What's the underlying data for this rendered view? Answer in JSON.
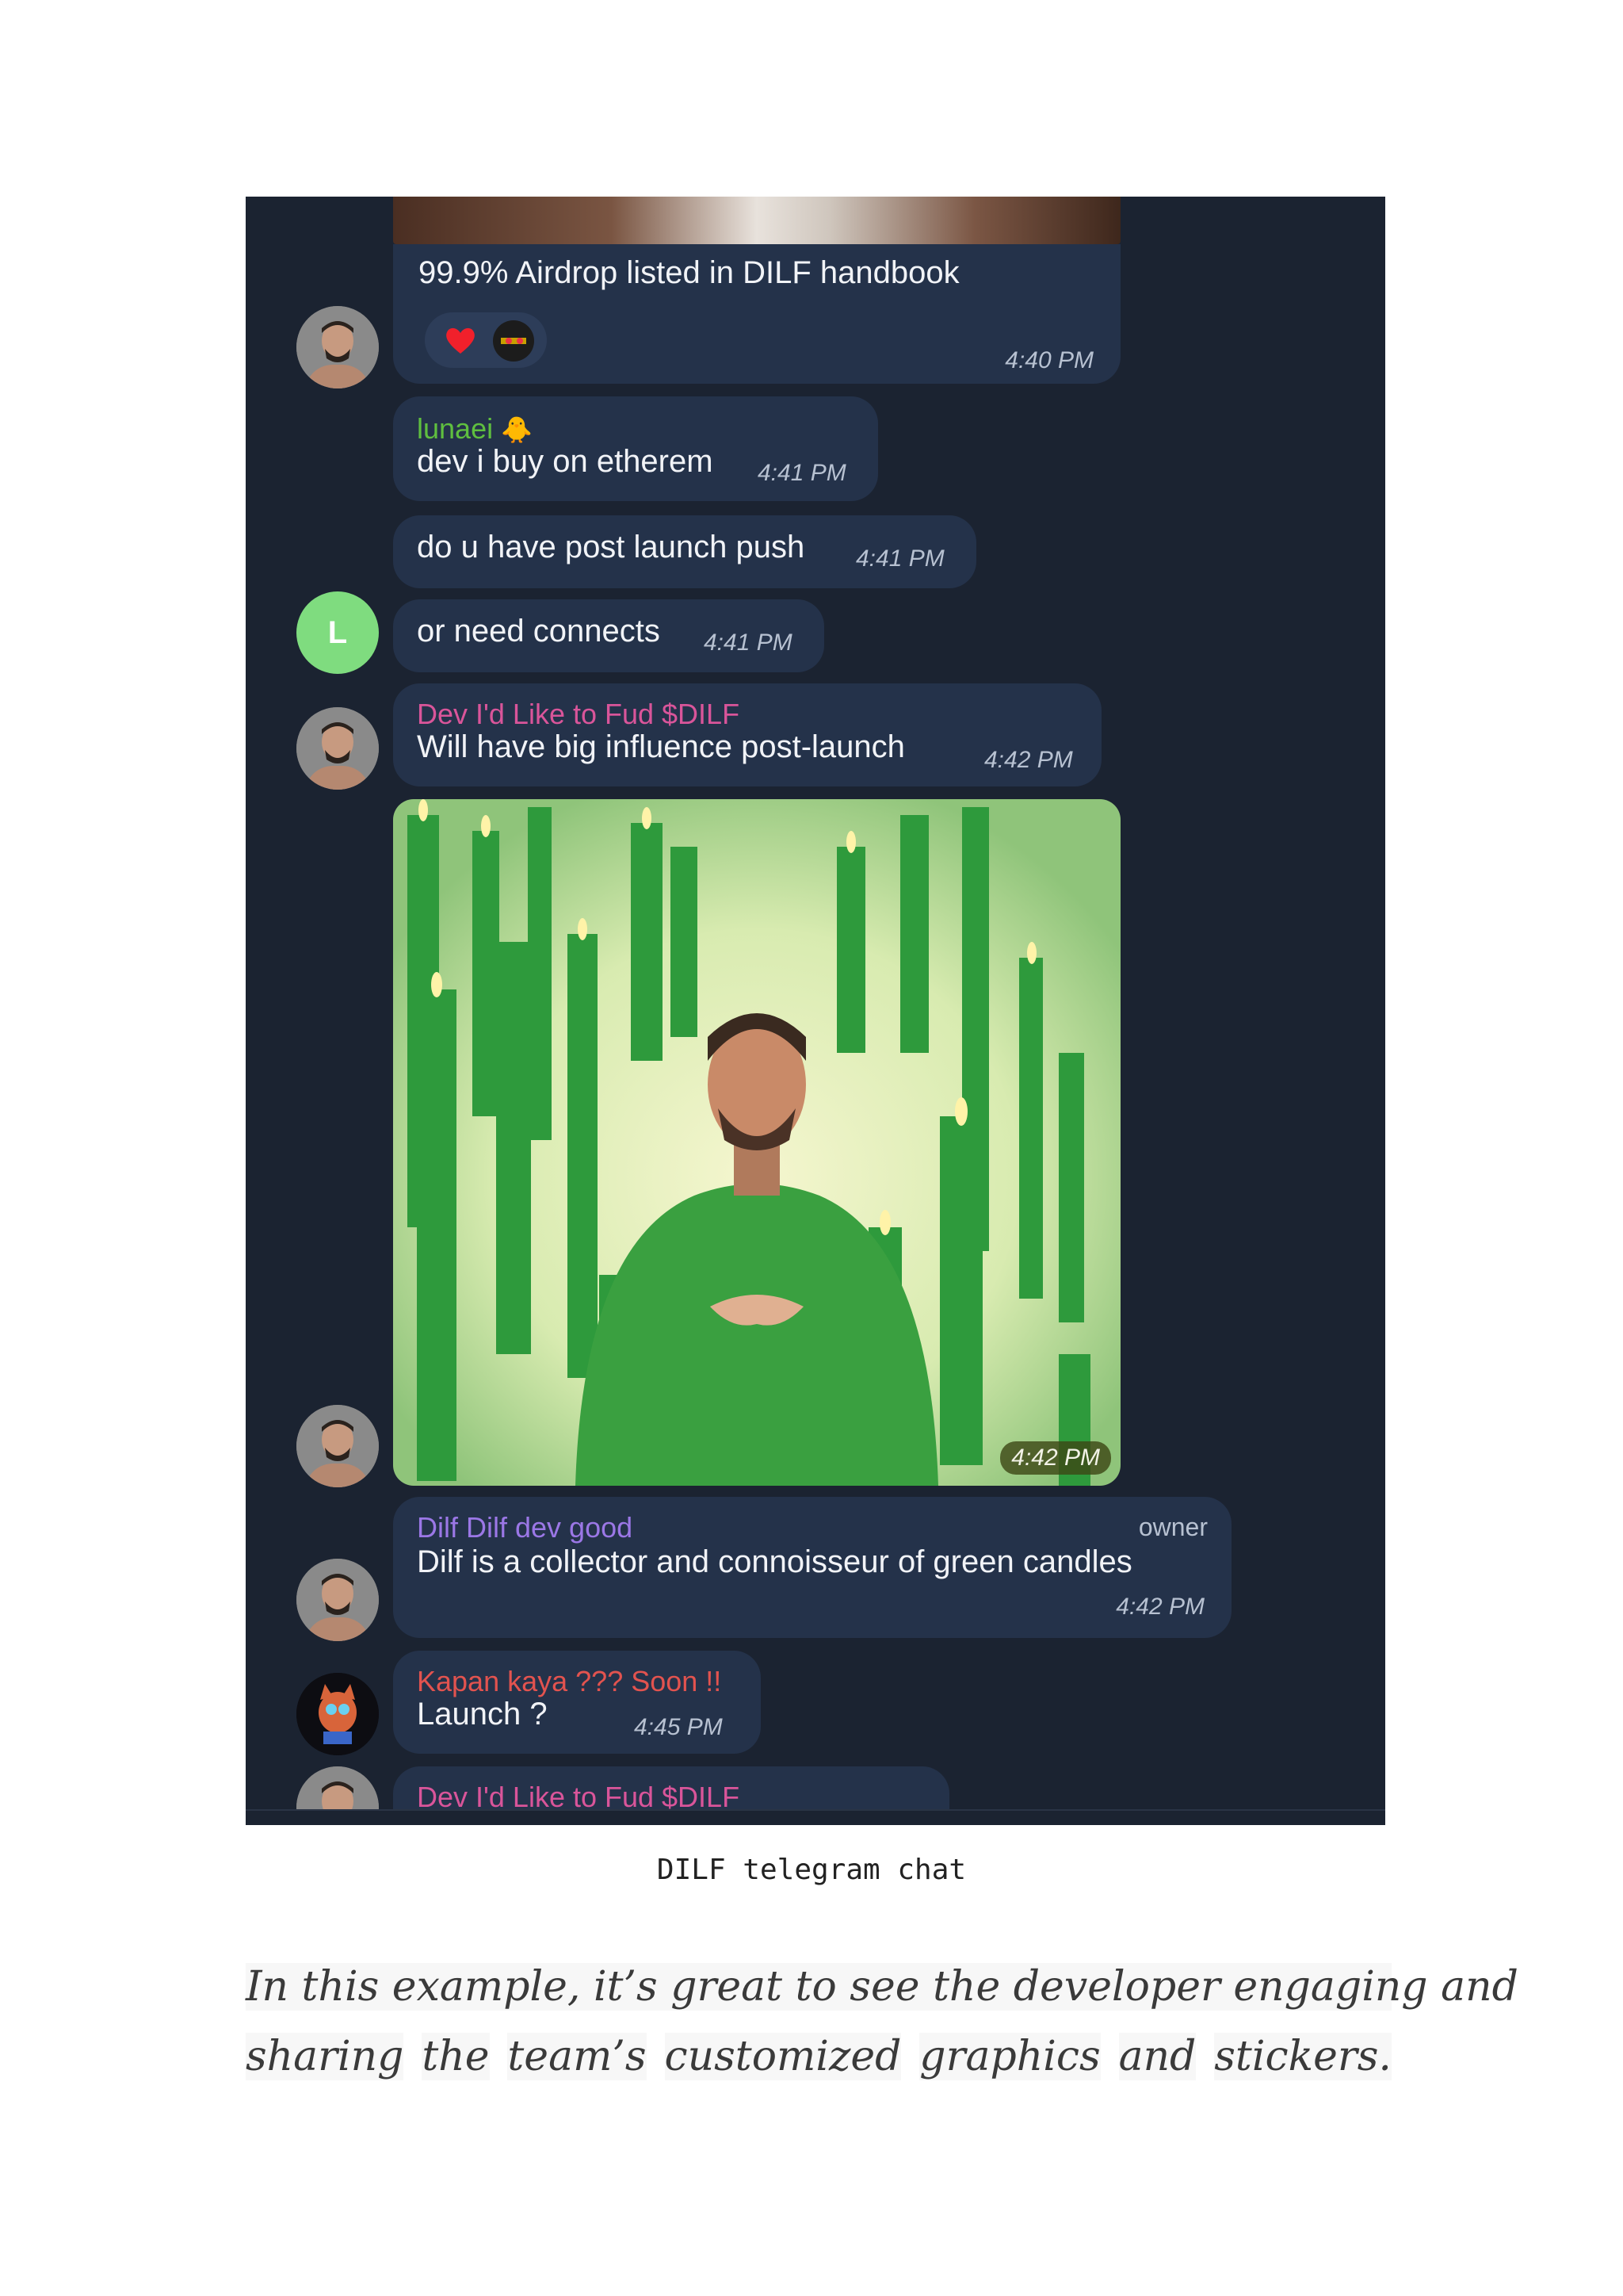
{
  "chat": {
    "msg_handbook": {
      "text": "99.9% Airdrop listed in DILF handbook",
      "time": "4:40 PM",
      "reactions": [
        "heart-icon",
        "sticker-thumb-icon"
      ]
    },
    "msg_lunaei": {
      "sender": "lunaei",
      "sender_emoji": "🐥",
      "text": "dev i buy on etherem",
      "time": "4:41 PM",
      "sender_color": "#5fbf3f"
    },
    "msg_push": {
      "text": "do u have post launch push",
      "time": "4:41 PM"
    },
    "msg_connects": {
      "text": "or need connects",
      "time": "4:41 PM",
      "avatar_letter": "L",
      "avatar_color": "#7fdc7f"
    },
    "msg_influence": {
      "sender": "Dev I'd Like to Fud $DILF",
      "text": "Will have big influence post-launch",
      "time": "4:42 PM",
      "sender_color": "#d9559a"
    },
    "msg_photo": {
      "time": "4:42 PM"
    },
    "msg_collector": {
      "sender": "Dilf Dilf dev good",
      "badge": "owner",
      "text": "Dilf is a collector and connoisseur of green candles",
      "time": "4:42 PM",
      "sender_color": "#9b77e6"
    },
    "msg_launch": {
      "sender": "Kapan kaya ??? Soon !!",
      "text": "Launch ?",
      "time": "4:45 PM",
      "sender_color": "#e2534f"
    },
    "msg_partial": {
      "sender": "Dev I'd Like to Fud $DILF",
      "sender_color": "#d9559a"
    }
  },
  "caption": "DILF telegram chat",
  "paragraph": {
    "line1": "In this example, it’s great to see the developer engaging and",
    "line2_words": [
      "sharing",
      "the",
      "team’s",
      "customized",
      "graphics",
      "and",
      "stickers."
    ]
  },
  "colors": {
    "chat_bg": "#1b2331",
    "bubble_bg": "#24324a"
  }
}
